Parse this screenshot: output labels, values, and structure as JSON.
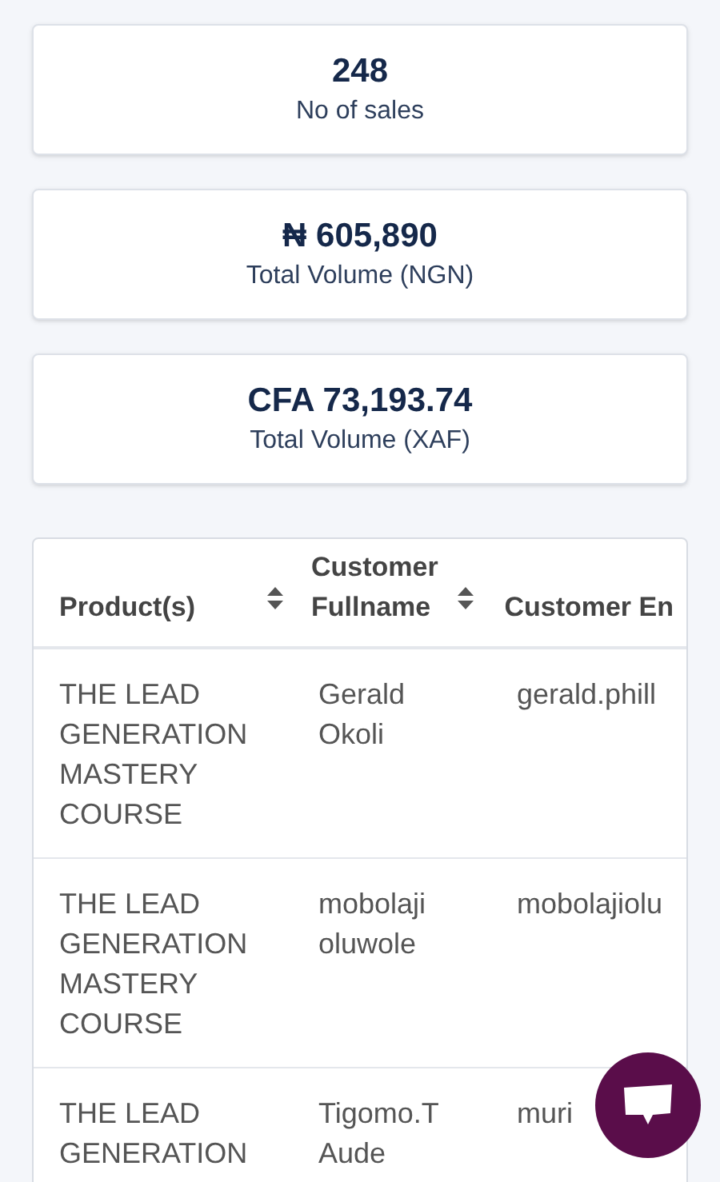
{
  "stats": [
    {
      "value": "248",
      "label": "No of sales"
    },
    {
      "value": "₦ 605,890",
      "label": "Total Volume (NGN)"
    },
    {
      "value": "CFA 73,193.74",
      "label": "Total Volume (XAF)"
    }
  ],
  "table": {
    "columns": [
      {
        "label": "Product(s)",
        "sortable": true
      },
      {
        "label": "Customer Fullname",
        "sortable": true
      },
      {
        "label": "Customer En",
        "sortable": false
      }
    ],
    "rows": [
      [
        "THE LEAD GENERATION MASTERY COURSE",
        "Gerald Okoli",
        "gerald.phill"
      ],
      [
        "THE LEAD GENERATION MASTERY COURSE",
        "mobolaji oluwole",
        "mobolajiolu"
      ],
      [
        "THE LEAD GENERATION",
        "Tigomo.T Aude",
        "muri"
      ]
    ]
  }
}
